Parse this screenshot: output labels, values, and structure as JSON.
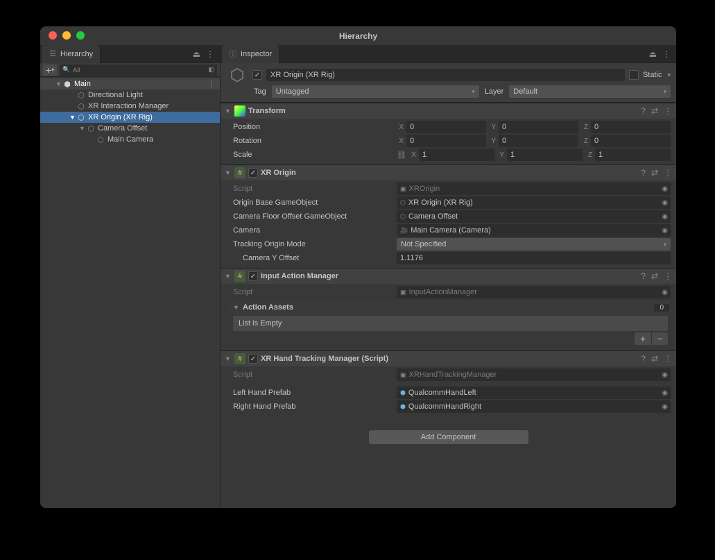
{
  "window": {
    "title": "Hierarchy"
  },
  "hierarchy": {
    "tab_label": "Hierarchy",
    "search_placeholder": "All",
    "items": [
      {
        "label": "Main"
      },
      {
        "label": "Directional Light"
      },
      {
        "label": "XR Interaction Manager"
      },
      {
        "label": "XR Origin (XR Rig)"
      },
      {
        "label": "Camera Offset"
      },
      {
        "label": "Main Camera"
      }
    ]
  },
  "inspector": {
    "tab_label": "Inspector",
    "name": "XR Origin (XR Rig)",
    "static_label": "Static",
    "tag_label": "Tag",
    "tag_value": "Untagged",
    "layer_label": "Layer",
    "layer_value": "Default",
    "transform": {
      "title": "Transform",
      "position_label": "Position",
      "rotation_label": "Rotation",
      "scale_label": "Scale",
      "position": {
        "x": "0",
        "y": "0",
        "z": "0"
      },
      "rotation": {
        "x": "0",
        "y": "0",
        "z": "0"
      },
      "scale": {
        "x": "1",
        "y": "1",
        "z": "1"
      }
    },
    "xr_origin": {
      "title": "XR Origin",
      "script_label": "Script",
      "script_value": "XROrigin",
      "origin_base_label": "Origin Base GameObject",
      "origin_base_value": "XR Origin (XR Rig)",
      "floor_offset_label": "Camera Floor Offset GameObject",
      "floor_offset_value": "Camera Offset",
      "camera_label": "Camera",
      "camera_value": "Main Camera (Camera)",
      "tracking_mode_label": "Tracking Origin Mode",
      "tracking_mode_value": "Not Specified",
      "y_offset_label": "Camera Y Offset",
      "y_offset_value": "1.1176"
    },
    "input_action": {
      "title": "Input Action Manager",
      "script_label": "Script",
      "script_value": "InputActionManager",
      "action_assets_label": "Action Assets",
      "action_assets_count": "0",
      "list_empty": "List is Empty"
    },
    "hand_tracking": {
      "title": "XR Hand Tracking Manager (Script)",
      "script_label": "Script",
      "script_value": "XRHandTrackingManager",
      "left_label": "Left Hand Prefab",
      "left_value": "QualcommHandLeft",
      "right_label": "Right Hand Prefab",
      "right_value": "QualcommHandRight"
    },
    "add_component": "Add Component"
  }
}
